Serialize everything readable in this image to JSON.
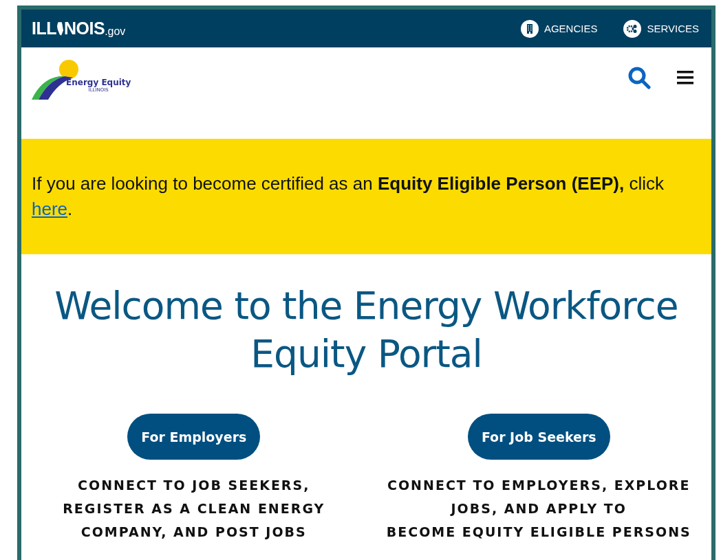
{
  "brand": {
    "before": "ILL",
    "after": "NOIS",
    "suffix": ".gov"
  },
  "top_links": [
    {
      "label": "AGENCIES",
      "kind": "building"
    },
    {
      "label": "SERVICES",
      "kind": "gears"
    }
  ],
  "logo": {
    "name": "Energy Equity",
    "state": "ILLINOIS"
  },
  "banner": "If you are looking to become certified as an **Equity Eligible Person (EEP),** click",
  "banner_link": "here",
  "banner_end": ".",
  "heading": "Welcome to the Energy Workforce Equity Portal",
  "audiences": [
    {
      "button": "For Employers",
      "lines": [
        "CONNECT TO JOB SEEKERS,",
        "REGISTER AS A CLEAN ENERGY",
        "COMPANY, AND POST JOBS"
      ]
    },
    {
      "button": "For Job Seekers",
      "lines": [
        "CONNECT TO EMPLOYERS, EXPLORE",
        "JOBS, AND APPLY TO",
        "BECOME EQUITY ELIGIBLE PERSONS"
      ]
    }
  ]
}
